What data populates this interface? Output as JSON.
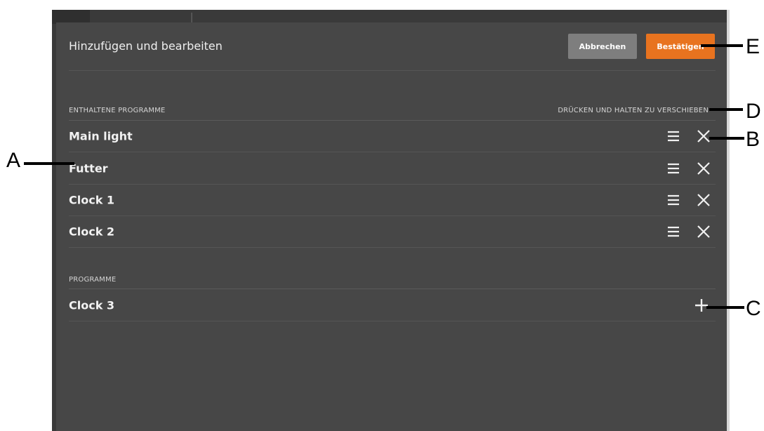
{
  "dialog": {
    "title": "Hinzufügen und bearbeiten",
    "cancel_label": "Abbrechen",
    "confirm_label": "Bestätigen"
  },
  "included_section": {
    "header": "ENTHALTENE PROGRAMME",
    "hint": "DRÜCKEN UND HALTEN ZU VERSCHIEBEN",
    "items": [
      {
        "label": "Main light"
      },
      {
        "label": "Futter"
      },
      {
        "label": "Clock 1"
      },
      {
        "label": "Clock 2"
      }
    ]
  },
  "available_section": {
    "header": "PROGRAMME",
    "items": [
      {
        "label": "Clock 3"
      }
    ]
  },
  "callouts": {
    "a": "A",
    "b": "B",
    "c": "C",
    "d": "D",
    "e": "E"
  },
  "icons": {
    "drag": "drag-handle-icon",
    "remove": "close-icon",
    "add": "plus-icon"
  },
  "colors": {
    "dialog_bg": "#474747",
    "cancel_button": "#7e7e7e",
    "confirm_button": "#e8731f",
    "text": "#f2f2f2"
  }
}
